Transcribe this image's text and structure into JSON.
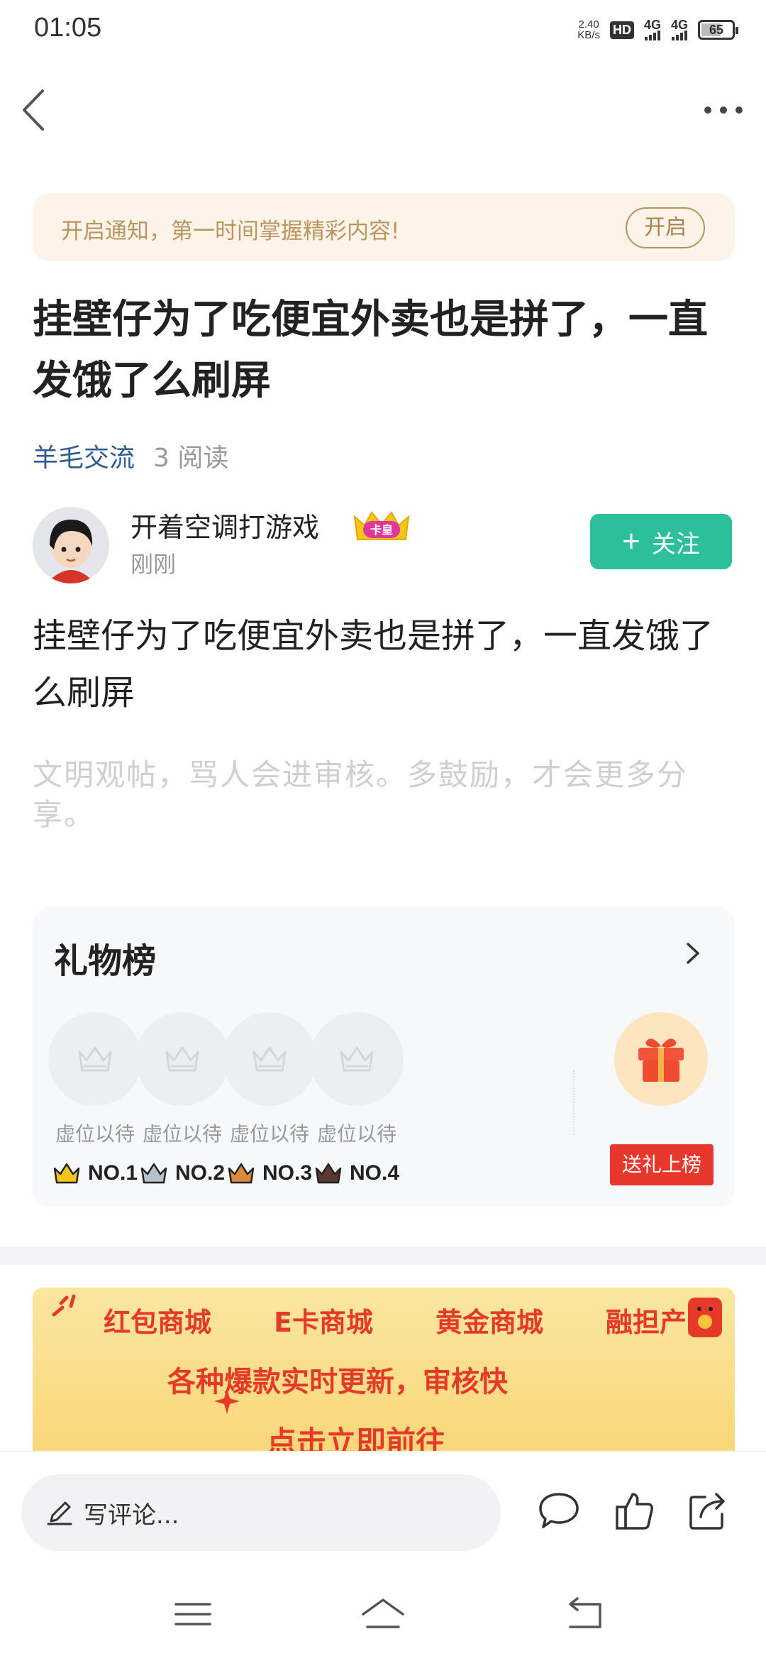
{
  "status_bar": {
    "time": "01:05",
    "speed_value": "2.40",
    "speed_unit": "KB/s",
    "hd": "HD",
    "sim1": "4G",
    "sim2": "4G",
    "battery": "65",
    "battery_level": 0.65
  },
  "notify": {
    "text": "开启通知，第一时间掌握精彩内容!",
    "button": "开启"
  },
  "post": {
    "title": "挂壁仔为了吃便宜外卖也是拼了，一直发饿了么刷屏",
    "category": "羊毛交流",
    "reads": "3 阅读",
    "body": "挂壁仔为了吃便宜外卖也是拼了，一直发饿了么刷屏",
    "civility_note": "文明观帖，骂人会进审核。多鼓励，才会更多分享。"
  },
  "author": {
    "name": "开着空调打游戏",
    "badge": "卡皇",
    "time": "刚刚",
    "follow_label": "关注"
  },
  "gift_board": {
    "title": "礼物榜",
    "slots": [
      {
        "label": "虚位以待",
        "rank": "NO.1",
        "crown_color": "#f5c518"
      },
      {
        "label": "虚位以待",
        "rank": "NO.2",
        "crown_color": "#b8c2cc"
      },
      {
        "label": "虚位以待",
        "rank": "NO.3",
        "crown_color": "#d98a3c"
      },
      {
        "label": "虚位以待",
        "rank": "NO.4",
        "crown_color": "#5a3a30"
      }
    ],
    "send_button": "送礼上榜"
  },
  "ad": {
    "row1": [
      "红包商城",
      "E卡商城",
      "黄金商城",
      "融担产品"
    ],
    "row2": "各种爆款实时更新，审核快",
    "row3": "点击立即前往"
  },
  "bottom_bar": {
    "comment_placeholder": "写评论..."
  },
  "colors": {
    "accent_green": "#2bbf9c",
    "link_blue": "#2f5c8f",
    "gift_red": "#e8372d"
  }
}
